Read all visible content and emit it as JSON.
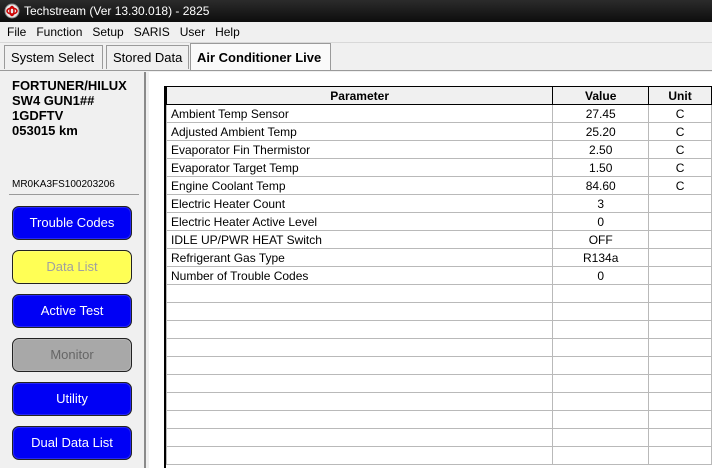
{
  "window": {
    "title": "Techstream (Ver 13.30.018) - 2825"
  },
  "menu": [
    "File",
    "Function",
    "Setup",
    "SARIS",
    "User",
    "Help"
  ],
  "tabs": [
    {
      "label": "System Select",
      "active": false
    },
    {
      "label": "Stored Data",
      "active": false
    },
    {
      "label": "Air Conditioner Live",
      "active": true
    }
  ],
  "vehicle": {
    "lines": [
      "FORTUNER/HILUX",
      "SW4 GUN1##",
      "1GDFTV",
      "053015 km"
    ],
    "vin": "MR0KA3FS100203206"
  },
  "buttons": [
    {
      "label": "Trouble Codes",
      "state": "blue"
    },
    {
      "label": "Data List",
      "state": "yellow"
    },
    {
      "label": "Active Test",
      "state": "blue"
    },
    {
      "label": "Monitor",
      "state": "gray"
    },
    {
      "label": "Utility",
      "state": "blue"
    },
    {
      "label": "Dual Data List",
      "state": "blue"
    }
  ],
  "colors": {
    "button_blue": "#0000f5",
    "button_yellow": "#ffff55",
    "button_gray": "#a8a8a8"
  },
  "grid": {
    "headers": [
      "Parameter",
      "Value",
      "Unit"
    ],
    "rows": [
      [
        "Ambient Temp Sensor",
        "27.45",
        "C"
      ],
      [
        "Adjusted Ambient Temp",
        "25.20",
        "C"
      ],
      [
        "Evaporator Fin Thermistor",
        "2.50",
        "C"
      ],
      [
        "Evaporator Target Temp",
        "1.50",
        "C"
      ],
      [
        "Engine Coolant Temp",
        "84.60",
        "C"
      ],
      [
        "Electric Heater Count",
        "3",
        ""
      ],
      [
        "Electric Heater Active Level",
        "0",
        ""
      ],
      [
        "IDLE UP/PWR HEAT Switch",
        "OFF",
        ""
      ],
      [
        "Refrigerant Gas Type",
        "R134a",
        ""
      ],
      [
        "Number of Trouble Codes",
        "0",
        ""
      ]
    ],
    "empty_rows": 10
  }
}
